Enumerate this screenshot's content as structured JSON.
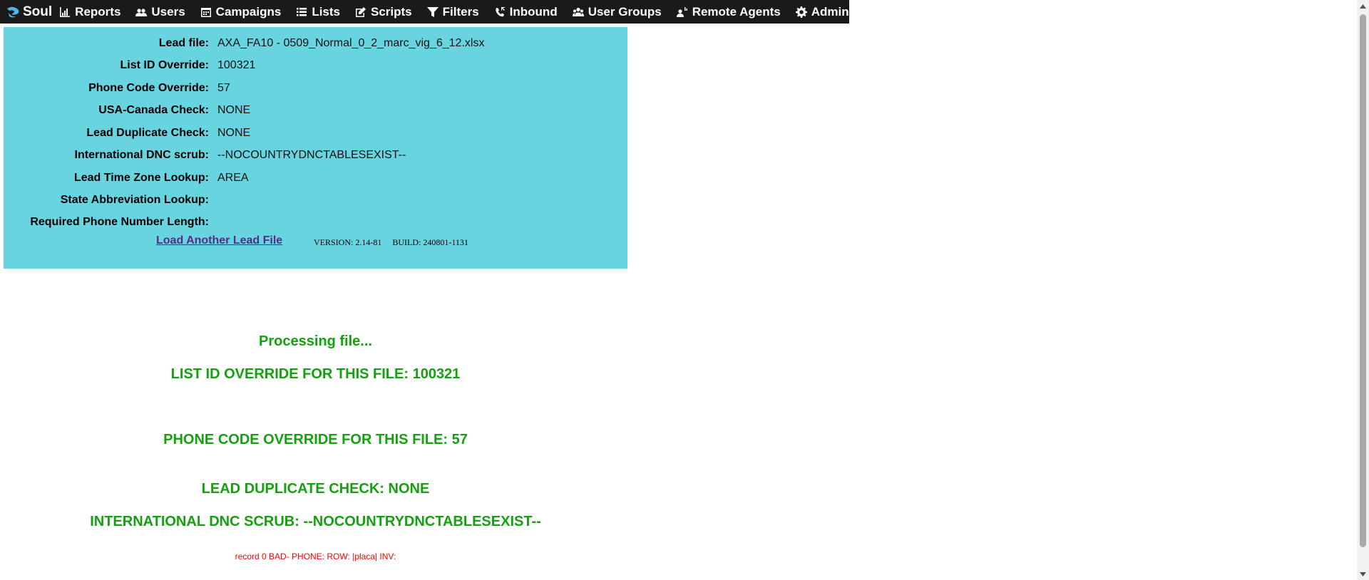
{
  "nav": {
    "brand": "Soul",
    "items": [
      {
        "label": "Reports",
        "icon": "bar-chart-icon"
      },
      {
        "label": "Users",
        "icon": "users-icon"
      },
      {
        "label": "Campaigns",
        "icon": "calendar-icon"
      },
      {
        "label": "Lists",
        "icon": "list-icon"
      },
      {
        "label": "Scripts",
        "icon": "edit-icon"
      },
      {
        "label": "Filters",
        "icon": "filter-icon"
      },
      {
        "label": "Inbound",
        "icon": "phone-incoming-icon"
      },
      {
        "label": "User Groups",
        "icon": "user-group-icon"
      },
      {
        "label": "Remote Agents",
        "icon": "remote-agent-icon"
      },
      {
        "label": "Admin",
        "icon": "gear-icon"
      }
    ]
  },
  "info": {
    "rows": [
      {
        "label": "Lead file:",
        "value": "AXA_FA10 - 0509_Normal_0_2_marc_vig_6_12.xlsx"
      },
      {
        "label": "List ID Override:",
        "value": "100321"
      },
      {
        "label": "Phone Code Override:",
        "value": "57"
      },
      {
        "label": "USA-Canada Check:",
        "value": "NONE"
      },
      {
        "label": "Lead Duplicate Check:",
        "value": "NONE"
      },
      {
        "label": "International DNC scrub:",
        "value": "--NOCOUNTRYDNCTABLESEXIST--"
      },
      {
        "label": "Lead Time Zone Lookup:",
        "value": "AREA"
      },
      {
        "label": "State Abbreviation Lookup:",
        "value": ""
      },
      {
        "label": "Required Phone Number Length:",
        "value": ""
      }
    ],
    "load_link": "Load Another Lead File",
    "version": "VERSION: 2.14-81     BUILD: 240801-1131"
  },
  "processing": {
    "status": "Processing file...",
    "list_override": "LIST ID OVERRIDE FOR THIS FILE: 100321",
    "phone_override": "PHONE CODE OVERRIDE FOR THIS FILE: 57",
    "dup_check": "LEAD DUPLICATE CHECK: NONE",
    "dnc_scrub": "INTERNATIONAL DNC SCRUB: --NOCOUNTRYDNCTABLESEXIST--",
    "record_error": "record 0 BAD- PHONE:  ROW: |placa| INV:"
  },
  "colors": {
    "nav_bg": "#1a1a1a",
    "panel_bg": "#68d4e0",
    "success_text": "#14a00f",
    "error_text": "#ff0000",
    "link": "#5a2a8a"
  }
}
